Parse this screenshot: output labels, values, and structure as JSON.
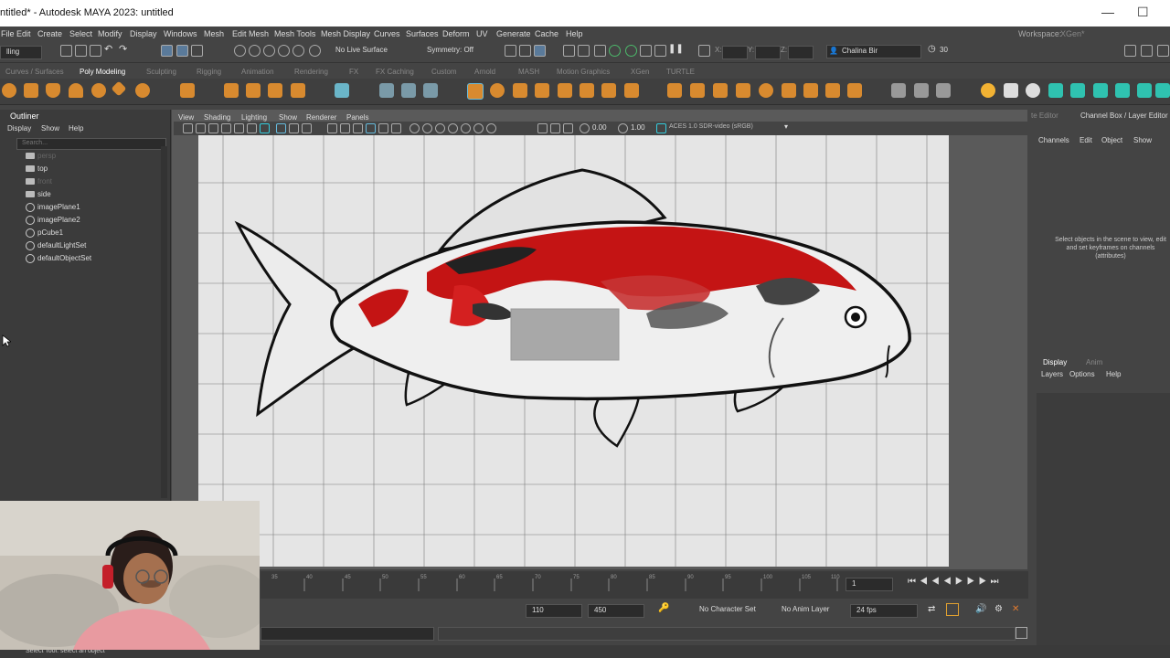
{
  "titlebar": {
    "title": "ntitled* - Autodesk MAYA 2023: untitled"
  },
  "menubar": {
    "items": [
      "File",
      "Edit",
      "Create",
      "Select",
      "Modify",
      "Display",
      "Windows",
      "Mesh",
      "Edit Mesh",
      "Mesh Tools",
      "Mesh Display",
      "Curves",
      "Surfaces",
      "Deform",
      "UV",
      "Generate",
      "Cache",
      "Help"
    ],
    "workspace_label": "Workspace:",
    "workspace_value": "XGen*"
  },
  "statusline": {
    "mode": "lling",
    "live_surface": "No Live Surface",
    "symmetry": "Symmetry: Off",
    "x": "X:",
    "y": "Y:",
    "z": "Z:",
    "user": "Chalina Bir",
    "frames": "30"
  },
  "shelftabs": [
    "Curves / Surfaces",
    "Poly Modeling",
    "Sculpting",
    "Rigging",
    "Animation",
    "Rendering",
    "FX",
    "FX Caching",
    "Custom",
    "Arnold",
    "MASH",
    "Motion Graphics",
    "XGen",
    "TURTLE"
  ],
  "shelf_active": "Poly Modeling",
  "outliner": {
    "title": "Outliner",
    "menu": [
      "Display",
      "Show",
      "Help"
    ],
    "search_placeholder": "Search...",
    "rows": [
      {
        "label": "persp",
        "dim": true,
        "icon": "camera-icon"
      },
      {
        "label": "top",
        "dim": false,
        "icon": "camera-icon"
      },
      {
        "label": "front",
        "dim": true,
        "icon": "camera-icon"
      },
      {
        "label": "side",
        "dim": false,
        "icon": "camera-icon"
      },
      {
        "label": "imagePlane1",
        "dim": false,
        "icon": "image-plane-icon"
      },
      {
        "label": "imagePlane2",
        "dim": false,
        "icon": "image-plane-icon"
      },
      {
        "label": "pCube1",
        "dim": false,
        "icon": "mesh-icon"
      },
      {
        "label": "defaultLightSet",
        "dim": false,
        "icon": "set-icon"
      },
      {
        "label": "defaultObjectSet",
        "dim": false,
        "icon": "set-icon"
      }
    ]
  },
  "viewport": {
    "menu": [
      "View",
      "Shading",
      "Lighting",
      "Show",
      "Renderer",
      "Panels"
    ],
    "exposure": "0.00",
    "gamma": "1.00",
    "colorspace": "ACES 1.0 SDR-video (sRGB)"
  },
  "rightpanel": {
    "tab_left": "te Editor",
    "tab_right": "Channel Box / Layer Editor",
    "menu": [
      "Channels",
      "Edit",
      "Object",
      "Show"
    ],
    "message": "Select objects in the scene to view, edit and set keyframes on channels (attributes)",
    "layer_tabs": [
      "Display",
      "Anim"
    ],
    "layer_menu": [
      "Layers",
      "Options",
      "Help"
    ]
  },
  "timeslider": {
    "ticks": [
      "35",
      "40",
      "45",
      "50",
      "55",
      "60",
      "65",
      "70",
      "75",
      "80",
      "85",
      "90",
      "95",
      "100",
      "105",
      "110"
    ],
    "current_frame": "1"
  },
  "rangeslider": {
    "end": "110",
    "anim_end": "450",
    "character_set": "No Character Set",
    "anim_layer": "No Anim Layer",
    "fps": "24 fps"
  },
  "helpline": {
    "text": "Select Tool: select an object"
  }
}
